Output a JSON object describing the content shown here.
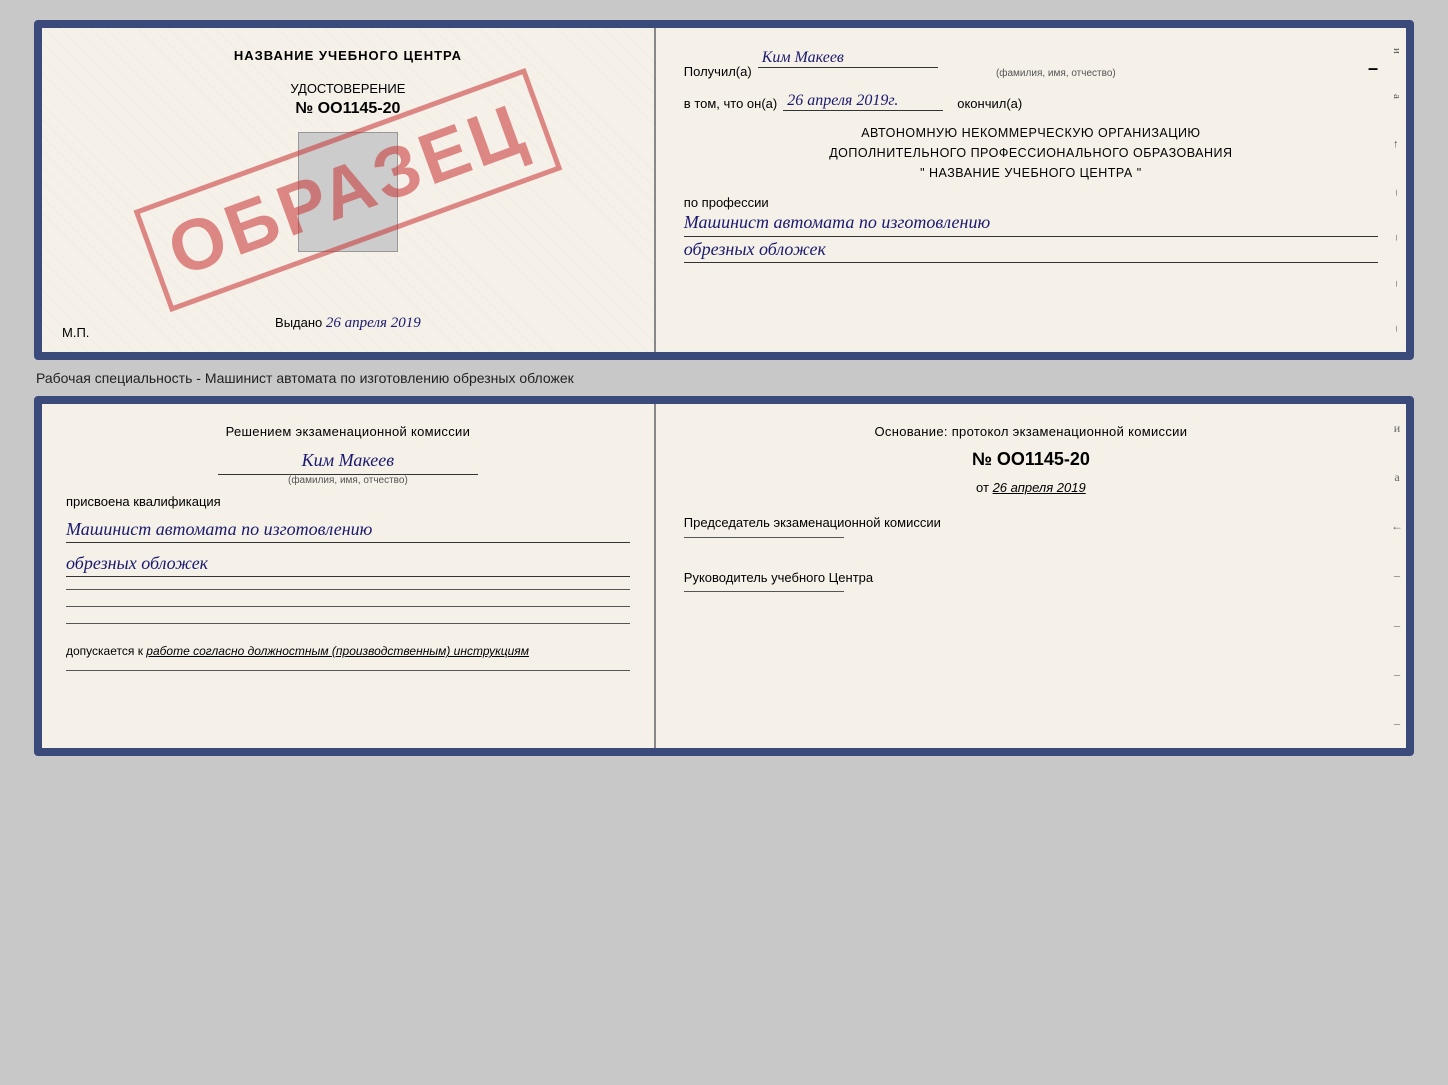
{
  "top_document": {
    "left": {
      "title": "НАЗВАНИЕ УЧЕБНОГО ЦЕНТРА",
      "watermark": "ОБРАЗЕЦ",
      "cert_subtitle": "УДОСТОВЕРЕНИЕ",
      "cert_number": "№ OO1145-20",
      "issued_label": "Выдано",
      "issued_date": "26 апреля 2019",
      "mp_label": "М.П."
    },
    "right": {
      "received_label": "Получил(а)",
      "received_name": "Ким Макеев",
      "name_hint": "(фамилия, имя, отчество)",
      "in_that_label": "в том, что он(а)",
      "completed_date": "26 апреля 2019г.",
      "completed_label": "окончил(а)",
      "org_line1": "АВТОНОМНУЮ НЕКОММЕРЧЕСКУЮ ОРГАНИЗАЦИЮ",
      "org_line2": "ДОПОЛНИТЕЛЬНОГО ПРОФЕССИОНАЛЬНОГО ОБРАЗОВАНИЯ",
      "org_line3": "\"   НАЗВАНИЕ УЧЕБНОГО ЦЕНТРА   \"",
      "profession_label": "по профессии",
      "profession_line1": "Машинист автомата по изготовлению",
      "profession_line2": "обрезных обложек"
    }
  },
  "caption": "Рабочая специальность - Машинист автомата по изготовлению обрезных обложек",
  "bottom_document": {
    "left": {
      "decision_text": "Решением экзаменационной комиссии",
      "person_name": "Ким Макеев",
      "name_hint": "(фамилия, имя, отчество)",
      "qualification_label": "присвоена квалификация",
      "qualification_line1": "Машинист автомата по изготовлению",
      "qualification_line2": "обрезных обложек",
      "допускается_label": "допускается к",
      "допускается_value": "работе согласно должностным (производственным) инструкциям"
    },
    "right": {
      "osnov_text": "Основание: протокол экзаменационной комиссии",
      "protocol_number": "№  OO1145-20",
      "protocol_date_prefix": "от",
      "protocol_date": "26 апреля 2019",
      "chairman_label": "Председатель экзаменационной комиссии",
      "director_label": "Руководитель учебного Центра",
      "side_chars": [
        "и",
        "а",
        "←",
        "–",
        "–",
        "–",
        "–"
      ]
    }
  }
}
